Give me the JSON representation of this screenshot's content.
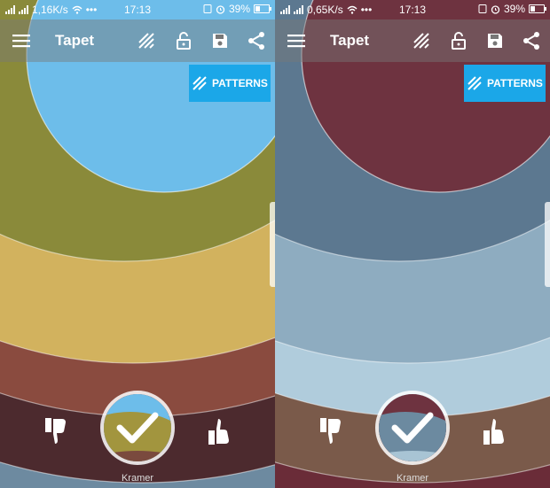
{
  "screens": [
    {
      "status": {
        "speed": "1,16K/s",
        "time": "17:13",
        "battery_text": "39%",
        "battery_level": 0.39
      },
      "toolbar": {
        "title": "Tapet"
      },
      "patterns_label": "PATTERNS",
      "author": "Kramer",
      "colors": {
        "base": "#6d8aa0",
        "ring5": "#4c2a2e",
        "ring4": "#8a4b3f",
        "ring3": "#d2b25e",
        "ring2": "#8a8a3a",
        "ring1": "#6dbdea",
        "btn_top": "#6dbdea",
        "btn_mid": "#a2953e",
        "btn_bottom": "#7a4a3e"
      }
    },
    {
      "status": {
        "speed": "0,65K/s",
        "time": "17:13",
        "battery_text": "39%",
        "battery_level": 0.39
      },
      "toolbar": {
        "title": "Tapet"
      },
      "patterns_label": "PATTERNS",
      "author": "Kramer",
      "colors": {
        "base": "#6a2c38",
        "ring5": "#7a5a4a",
        "ring4": "#b0ccdc",
        "ring3": "#8eacc0",
        "ring2": "#5c7890",
        "ring1": "#6e3340",
        "btn_top": "#6e3340",
        "btn_mid": "#6c8aa0",
        "btn_bottom": "#a8c4d4"
      }
    }
  ]
}
